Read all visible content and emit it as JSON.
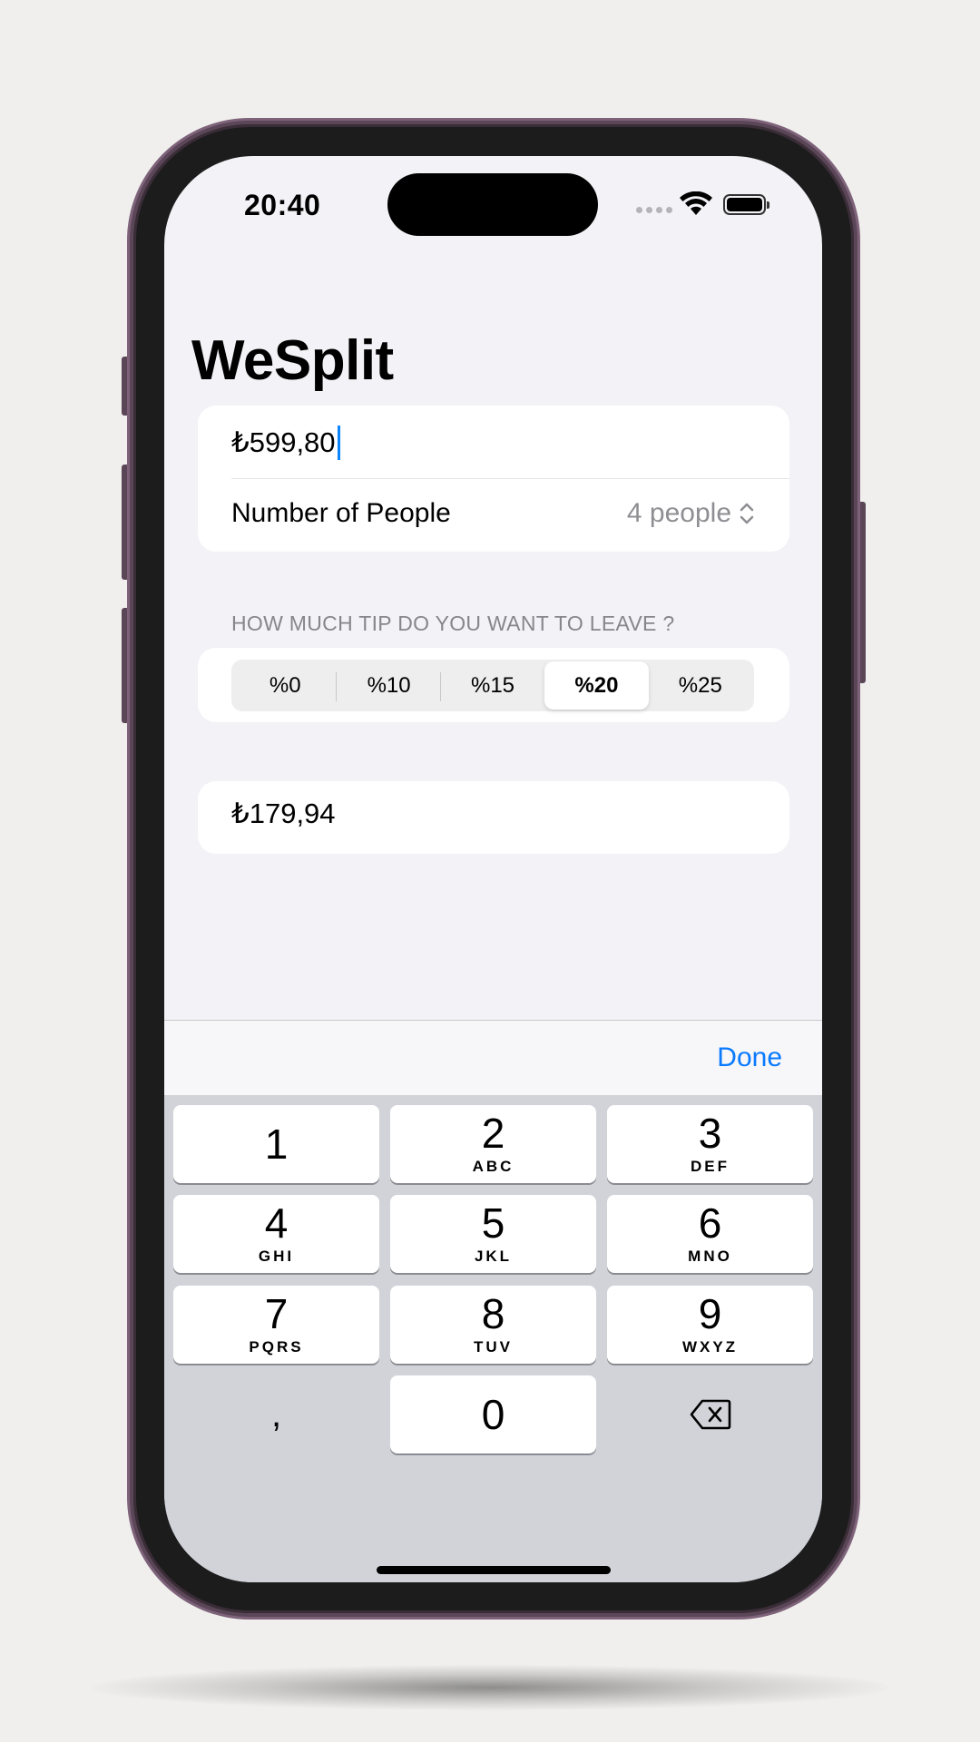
{
  "status_bar": {
    "time": "20:40"
  },
  "app": {
    "title": "WeSplit"
  },
  "form": {
    "amount": "₺599,80",
    "people_label": "Number of People",
    "people_value": "4 people",
    "tip_header": "HOW MUCH TIP DO YOU WANT TO LEAVE ?",
    "tip_options": [
      "%0",
      "%10",
      "%15",
      "%20",
      "%25"
    ],
    "tip_selected": "%20",
    "total": "₺179,94"
  },
  "keyboard": {
    "done_label": "Done",
    "keys": [
      {
        "num": "1",
        "letters": ""
      },
      {
        "num": "2",
        "letters": "ABC"
      },
      {
        "num": "3",
        "letters": "DEF"
      },
      {
        "num": "4",
        "letters": "GHI"
      },
      {
        "num": "5",
        "letters": "JKL"
      },
      {
        "num": "6",
        "letters": "MNO"
      },
      {
        "num": "7",
        "letters": "PQRS"
      },
      {
        "num": "8",
        "letters": "TUV"
      },
      {
        "num": "9",
        "letters": "WXYZ"
      }
    ],
    "decimal_key": ",",
    "zero_key": "0",
    "delete_icon": "delete-left-icon"
  },
  "colors": {
    "accent": "#0a7aff",
    "background": "#f2f2f7",
    "keyboard": "#d1d3d9",
    "phone_frame": "#5b4658"
  }
}
